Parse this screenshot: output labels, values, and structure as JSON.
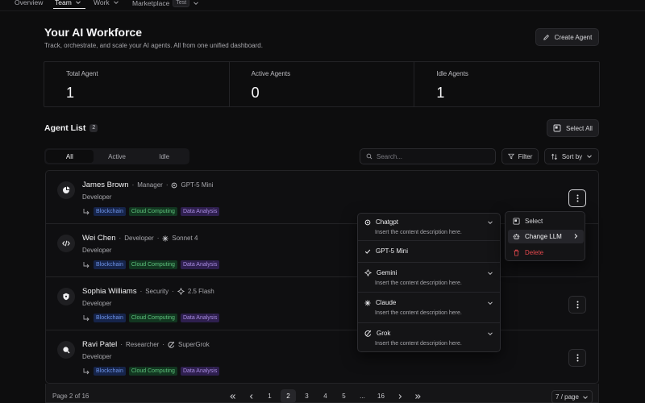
{
  "nav": {
    "items": [
      {
        "label": "Overview"
      },
      {
        "label": "Team"
      },
      {
        "label": "Work"
      },
      {
        "label": "Marketplace",
        "badge": "Test"
      }
    ],
    "active": "Team"
  },
  "header": {
    "title": "Your AI Workforce",
    "subtitle": "Track, orchestrate, and scale your AI agents. All from one unified dashboard.",
    "create_label": "Create Agent"
  },
  "stats": [
    {
      "label": "Total Agent",
      "value": "1"
    },
    {
      "label": "Active Agents",
      "value": "0"
    },
    {
      "label": "Idle Agents",
      "value": "1"
    }
  ],
  "list": {
    "title": "Agent List",
    "count": "2",
    "select_all_label": "Select All",
    "tabs": [
      "All",
      "Active",
      "Idle"
    ],
    "active_tab": "All",
    "search_placeholder": "Search...",
    "filter_label": "Filter",
    "sort_label": "Sort by"
  },
  "agents": [
    {
      "name": "James Brown",
      "type": "Manager",
      "model": "GPT-5 Mini",
      "model_icon": "openai-icon",
      "role": "Developer",
      "tags": [
        "Blockchain",
        "Cloud Computing",
        "Data Analysis"
      ]
    },
    {
      "name": "Wei Chen",
      "type": "Developer",
      "model": "Sonnet 4",
      "model_icon": "anthropic-icon",
      "role": "Developer",
      "tags": [
        "Blockchain",
        "Cloud Computing",
        "Data Analysis"
      ]
    },
    {
      "name": "Sophia Williams",
      "type": "Security",
      "model": "2.5 Flash",
      "model_icon": "gemini-icon",
      "role": "Developer",
      "tags": [
        "Blockchain",
        "Cloud Computing",
        "Data Analysis"
      ]
    },
    {
      "name": "Ravi Patel",
      "type": "Researcher",
      "model": "SuperGrok",
      "model_icon": "grok-icon",
      "role": "Developer",
      "tags": [
        "Blockchain",
        "Cloud Computing",
        "Data Analysis"
      ]
    }
  ],
  "tag_colors": {
    "Blockchain": "#6d93e8",
    "Cloud Computing": "#5dc27c",
    "Data Analysis": "#a78be0"
  },
  "pagination": {
    "info": "Page 2 of 16",
    "pages": [
      "1",
      "2",
      "3",
      "4",
      "5",
      "...",
      "16"
    ],
    "current": "2",
    "per_page": "7 / page"
  },
  "llm_menu": {
    "items": [
      {
        "name": "Chatgpt",
        "desc": "Insert the content description here.",
        "icon": "openai-icon"
      },
      {
        "name": "GPT-5 Mini",
        "desc": "",
        "icon": "check-icon",
        "selected": true
      },
      {
        "name": "Gemini",
        "desc": "Insert the content description here.",
        "icon": "gemini-icon"
      },
      {
        "name": "Claude",
        "desc": "Insert the content description here.",
        "icon": "anthropic-icon"
      },
      {
        "name": "Grok",
        "desc": "Insert the content description here.",
        "icon": "grok-icon"
      }
    ]
  },
  "action_menu": {
    "select_label": "Select",
    "change_llm_label": "Change LLM",
    "delete_label": "Delete"
  }
}
